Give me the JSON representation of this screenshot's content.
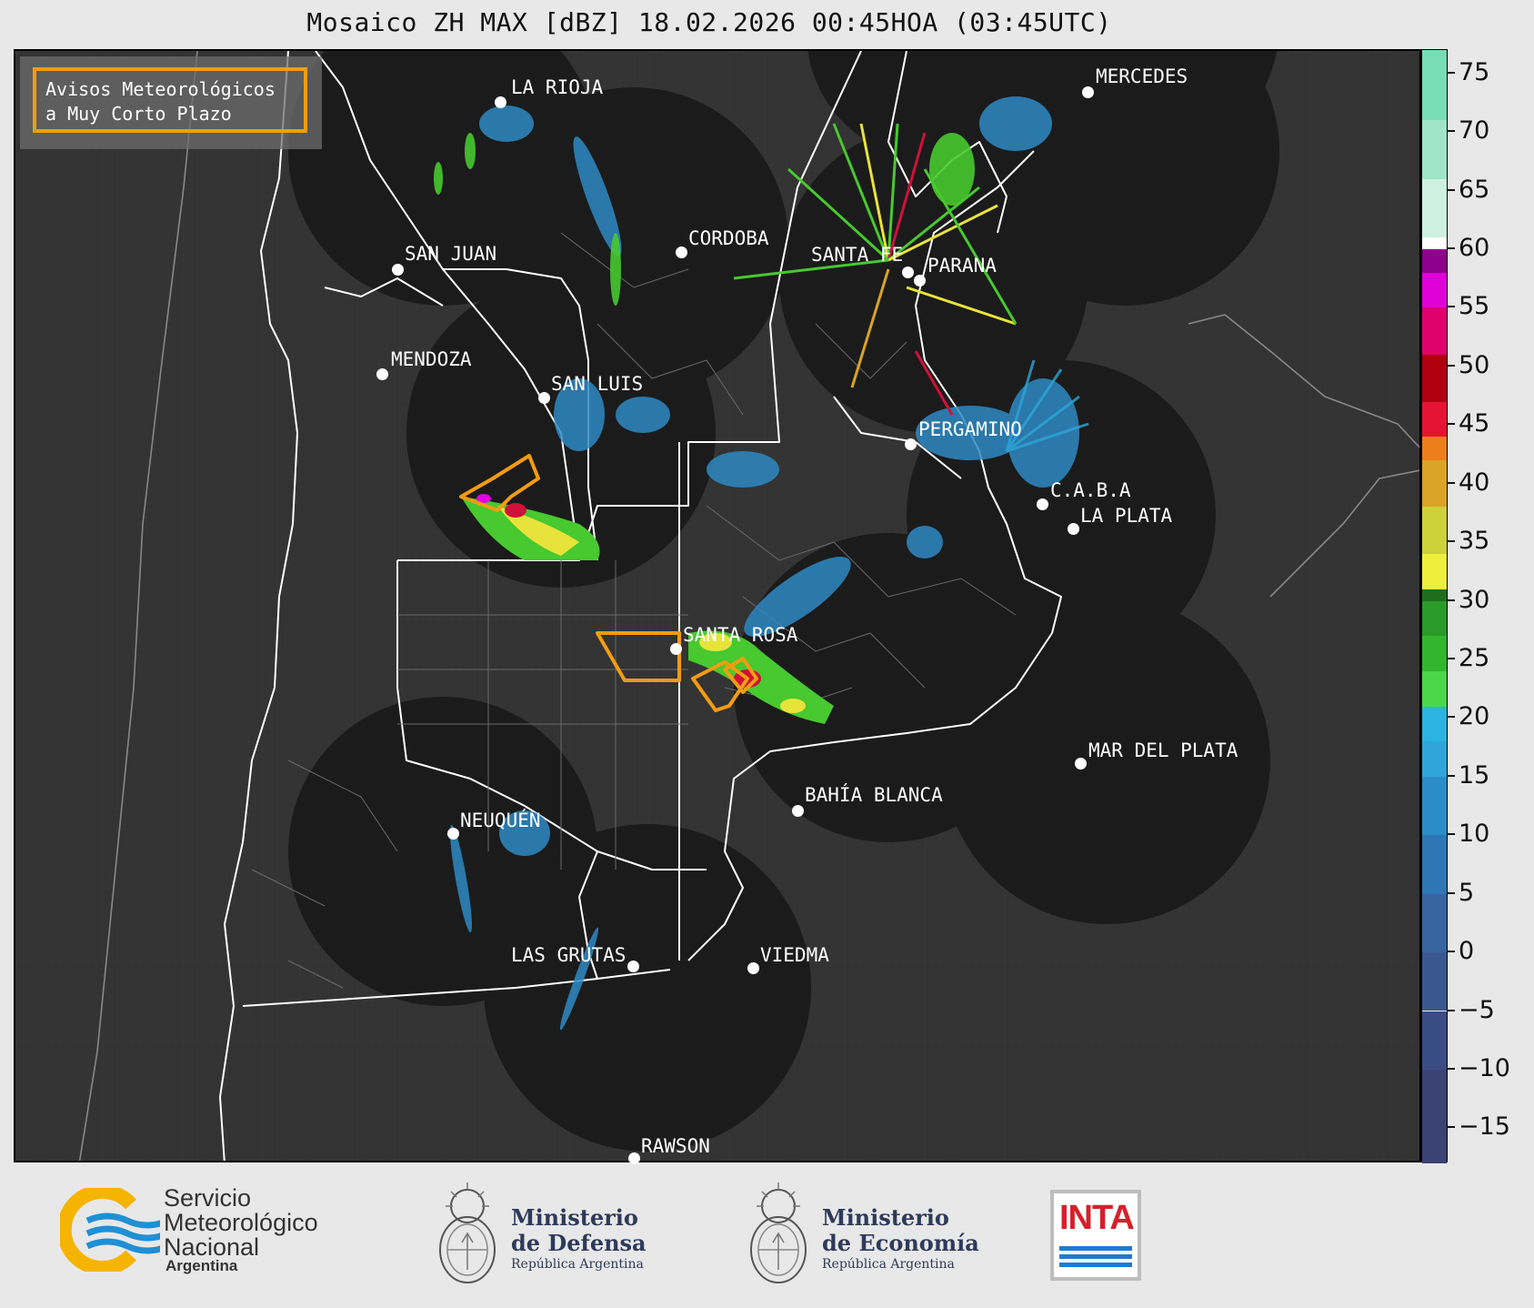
{
  "title": "Mosaico ZH MAX [dBZ] 18.02.2026 00:45HOA (03:45UTC)",
  "legend": {
    "line1": "Avisos Meteorológicos",
    "line2": "a Muy Corto Plazo",
    "border_color": "#f39c12"
  },
  "colors": {
    "map_background": "#333333",
    "radar_coverage": "#1b1b1b",
    "borders": "#ffffff",
    "warning_polygon": "#f39c12",
    "echo_weak": "#2f8ac4",
    "echo_moderate": "#47c92f",
    "echo_strong": "#e8e33a",
    "echo_severe": "#d0103a",
    "echo_extreme": "#e000e0"
  },
  "colorbar": {
    "unit": "dBZ",
    "range": [
      -18,
      77
    ],
    "ticks": [
      "75",
      "70",
      "65",
      "60",
      "55",
      "50",
      "45",
      "40",
      "35",
      "30",
      "25",
      "20",
      "15",
      "10",
      "5",
      "0",
      "−5",
      "−10",
      "−15"
    ],
    "tick_values": [
      75,
      70,
      65,
      60,
      55,
      50,
      45,
      40,
      35,
      30,
      25,
      20,
      15,
      10,
      5,
      0,
      -5,
      -10,
      -15
    ],
    "bands": [
      {
        "from": -18,
        "to": -10,
        "color": "#3b4274"
      },
      {
        "from": -10,
        "to": -5,
        "color": "#3a4c84"
      },
      {
        "from": -5,
        "to": 0,
        "color": "#39588f"
      },
      {
        "from": 0,
        "to": 5,
        "color": "#3865a0"
      },
      {
        "from": 5,
        "to": 10,
        "color": "#2f76b4"
      },
      {
        "from": 10,
        "to": 15,
        "color": "#2b8cc8"
      },
      {
        "from": 15,
        "to": 18,
        "color": "#2ea6d8"
      },
      {
        "from": 18,
        "to": 21,
        "color": "#2cb3e0"
      },
      {
        "from": 21,
        "to": 24,
        "color": "#4ad84a"
      },
      {
        "from": 24,
        "to": 27,
        "color": "#33b52e"
      },
      {
        "from": 27,
        "to": 30,
        "color": "#2a9a28"
      },
      {
        "from": 30,
        "to": 31,
        "color": "#1e6e1e"
      },
      {
        "from": 31,
        "to": 34,
        "color": "#eeee3c"
      },
      {
        "from": 34,
        "to": 38,
        "color": "#cdd23a"
      },
      {
        "from": 38,
        "to": 42,
        "color": "#d9a326"
      },
      {
        "from": 42,
        "to": 44,
        "color": "#ee7e1a"
      },
      {
        "from": 44,
        "to": 47,
        "color": "#e61432"
      },
      {
        "from": 47,
        "to": 51,
        "color": "#b00010"
      },
      {
        "from": 51,
        "to": 55,
        "color": "#e0006e"
      },
      {
        "from": 55,
        "to": 58,
        "color": "#e000d8"
      },
      {
        "from": 58,
        "to": 60,
        "color": "#8e008e"
      },
      {
        "from": 60,
        "to": 61,
        "color": "#ffffff"
      },
      {
        "from": 61,
        "to": 66,
        "color": "#cdf0e0"
      },
      {
        "from": 66,
        "to": 71,
        "color": "#a0e4c8"
      },
      {
        "from": 71,
        "to": 77,
        "color": "#78dcb4"
      }
    ]
  },
  "cities": [
    {
      "name": "LA RIOJA"
    },
    {
      "name": "MERCEDES"
    },
    {
      "name": "SAN JUAN"
    },
    {
      "name": "CORDOBA"
    },
    {
      "name": "SANTA FE"
    },
    {
      "name": "PARANA"
    },
    {
      "name": "MENDOZA"
    },
    {
      "name": "SAN LUIS"
    },
    {
      "name": "PERGAMINO"
    },
    {
      "name": "C.A.B.A"
    },
    {
      "name": "LA PLATA"
    },
    {
      "name": "SANTA ROSA"
    },
    {
      "name": "MAR DEL PLATA"
    },
    {
      "name": "BAHÍA BLANCA"
    },
    {
      "name": "NEUQUÉN"
    },
    {
      "name": "LAS GRUTAS"
    },
    {
      "name": "VIEDMA"
    },
    {
      "name": "RAWSON"
    }
  ],
  "logos": {
    "smn": {
      "line1": "Servicio",
      "line2": "Meteorológico",
      "line3": "Nacional",
      "line4": "Argentina"
    },
    "defensa": {
      "line1": "Ministerio",
      "line2": "de Defensa",
      "line3": "República Argentina"
    },
    "economia": {
      "line1": "Ministerio",
      "line2": "de Economía",
      "line3": "República Argentina"
    },
    "inta": {
      "text": "INTA"
    }
  }
}
